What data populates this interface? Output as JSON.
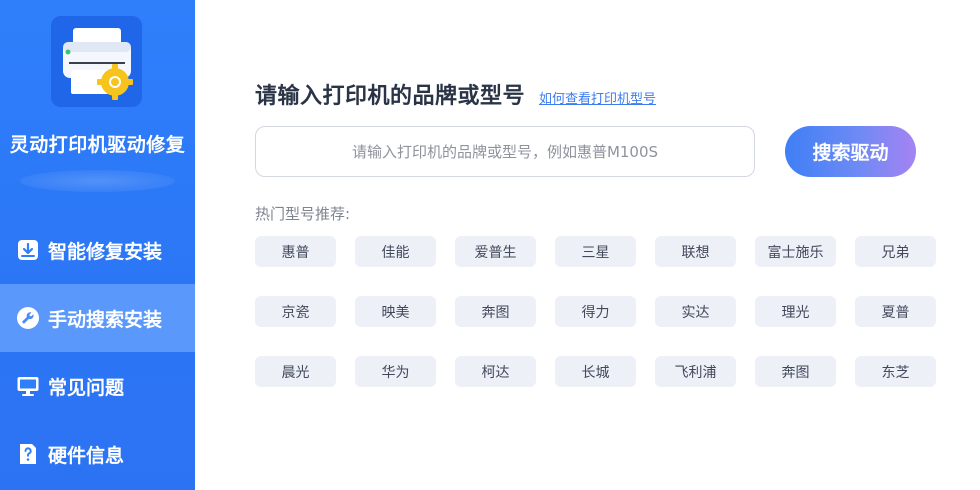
{
  "app": {
    "title": "灵动打印机驱动修复"
  },
  "sidebar": {
    "items": [
      {
        "label": "智能修复安装",
        "icon": "download-box-icon",
        "active": false
      },
      {
        "label": "手动搜索安装",
        "icon": "wrench-icon",
        "active": true
      },
      {
        "label": "常见问题",
        "icon": "monitor-icon",
        "active": false
      },
      {
        "label": "硬件信息",
        "icon": "question-doc-icon",
        "active": false
      }
    ]
  },
  "main": {
    "heading": "请输入打印机的品牌或型号",
    "help_link": "如何查看打印机型号",
    "search": {
      "placeholder": "请输入打印机的品牌或型号，例如惠普M100S",
      "value": ""
    },
    "search_button": "搜索驱动",
    "hot_label": "热门型号推荐:",
    "hot_rows": [
      [
        "惠普",
        "佳能",
        "爱普生",
        "三星",
        "联想",
        "富士施乐",
        "兄弟"
      ],
      [
        "京瓷",
        "映美",
        "奔图",
        "得力",
        "实达",
        "理光",
        "夏普"
      ],
      [
        "晨光",
        "华为",
        "柯达",
        "长城",
        "飞利浦",
        "奔图",
        "东芝"
      ]
    ]
  },
  "colors": {
    "sidebar": "#2c78f6",
    "active_item": "#5a98fb",
    "accent": "#3d7cf0",
    "tag_bg": "#eef0f8"
  }
}
